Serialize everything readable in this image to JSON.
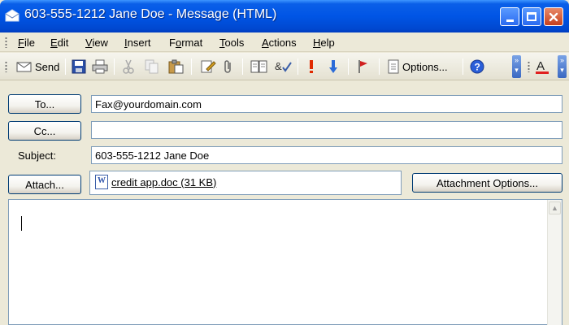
{
  "window": {
    "title": "603-555-1212 Jane Doe - Message (HTML)"
  },
  "menu": [
    {
      "label": "File",
      "accel": "F",
      "rest": "ile"
    },
    {
      "label": "Edit",
      "accel": "E",
      "rest": "dit"
    },
    {
      "label": "View",
      "accel": "V",
      "rest": "iew"
    },
    {
      "label": "Insert",
      "accel": "I",
      "rest": "nsert"
    },
    {
      "label": "Format",
      "accel": "o",
      "pre": "F",
      "rest": "rmat"
    },
    {
      "label": "Tools",
      "accel": "T",
      "rest": "ools"
    },
    {
      "label": "Actions",
      "accel": "A",
      "rest": "ctions"
    },
    {
      "label": "Help",
      "accel": "H",
      "rest": "elp"
    }
  ],
  "toolbar": {
    "send_label": "Send",
    "options_label": "Options..."
  },
  "icons": {
    "send": "send-icon",
    "save": "save-icon",
    "print": "print-icon",
    "cut": "cut-icon",
    "copy": "copy-icon",
    "paste": "paste-icon",
    "insert_file": "insert-file-icon",
    "attach": "paperclip-icon",
    "address_book": "address-book-icon",
    "check_names": "check-names-icon",
    "importance_high": "importance-high-icon",
    "importance_low": "importance-low-icon",
    "flag": "flag-icon",
    "options": "options-icon",
    "help": "help-icon",
    "font_color": "font-color-icon"
  },
  "form": {
    "to_button": "To...",
    "cc_button": "Cc...",
    "subject_label": "Subject:",
    "attach_button": "Attach...",
    "attachment_options_button": "Attachment Options...",
    "to_value": "Fax@yourdomain.com",
    "cc_value": "",
    "subject_value": "603-555-1212 Jane Doe",
    "attachment": "credit app.doc (31 KB)"
  },
  "colors": {
    "titlebar": "#0055e5",
    "chrome": "#ece9d8",
    "button_border": "#003c74",
    "field_border": "#7f9db9"
  }
}
